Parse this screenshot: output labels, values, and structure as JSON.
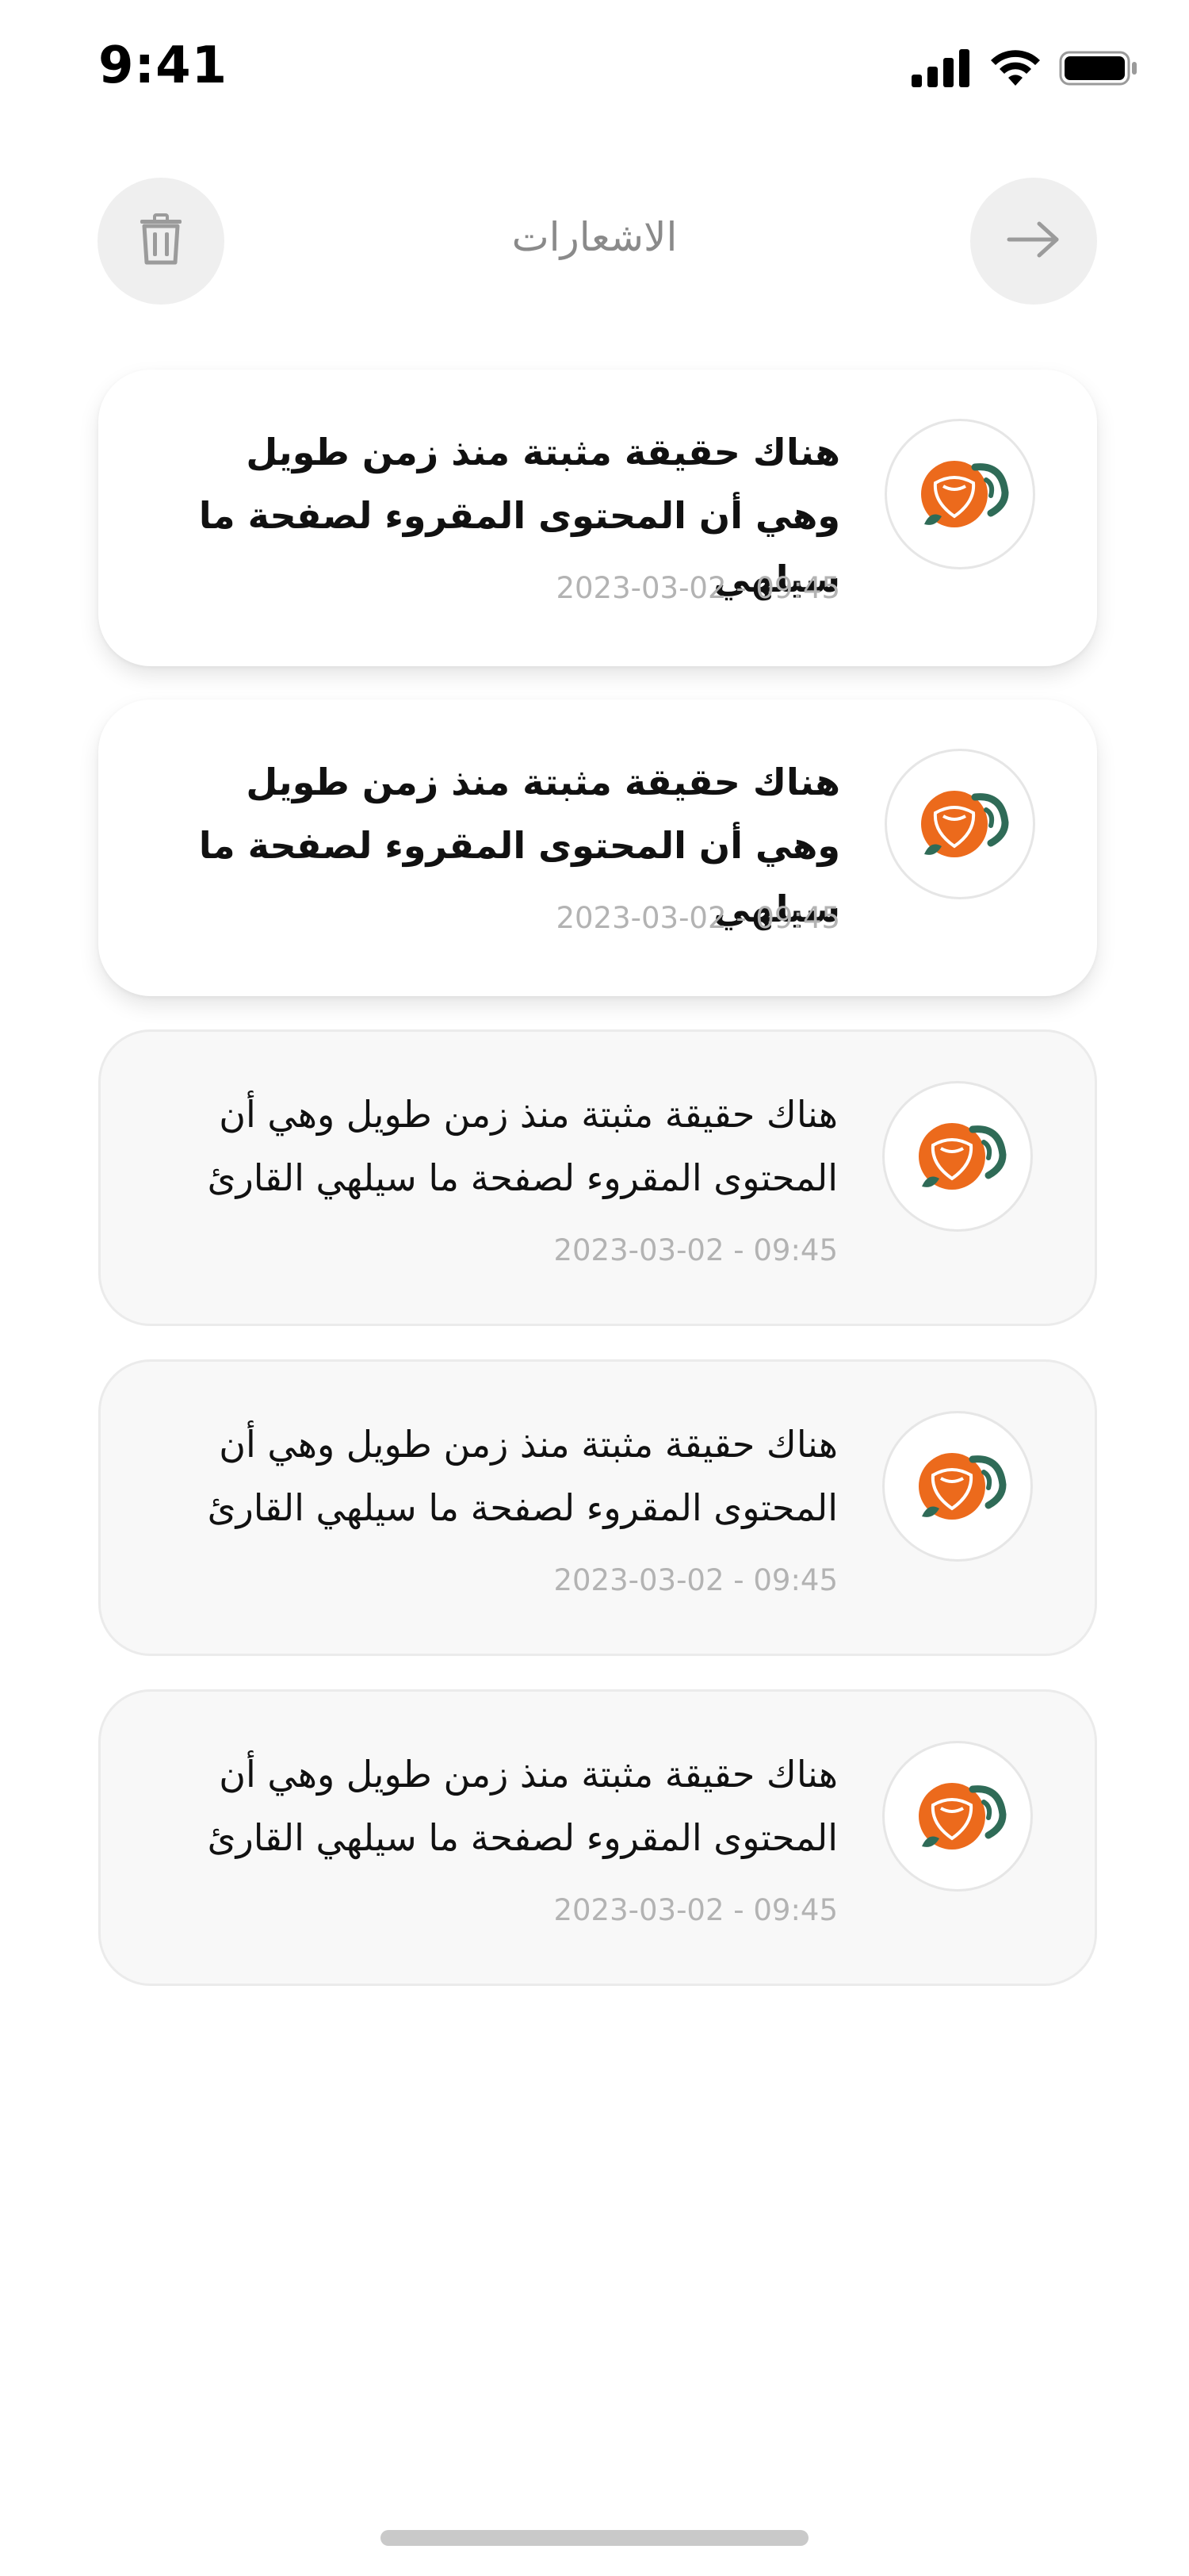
{
  "status_bar": {
    "time": "9:41",
    "icons": [
      "cellular-signal-icon",
      "wifi-icon",
      "battery-icon"
    ]
  },
  "header": {
    "title": "الاشعارات",
    "left_icon": "trash-icon",
    "right_icon": "arrow-right-icon"
  },
  "colors": {
    "brand_orange": "#ec6a1c",
    "brand_green": "#2f6b57",
    "unread_bg": "#ffffff",
    "read_bg": "#f8f8f8",
    "timestamp": "#b3b3b3",
    "title": "#8a8a8a"
  },
  "notifications": [
    {
      "text": "هناك حقيقة مثبتة منذ زمن طويل وهي أن المحتوى المقروء لصفحة ما سيلهي",
      "timestamp": "2023-03-02 - 09:45",
      "read": false,
      "icon": "brand-logo-icon"
    },
    {
      "text": "هناك حقيقة مثبتة منذ زمن طويل وهي أن المحتوى المقروء لصفحة ما سيلهي",
      "timestamp": "2023-03-02 - 09:45",
      "read": false,
      "icon": "brand-logo-icon"
    },
    {
      "text": "هناك حقيقة مثبتة منذ زمن طويل وهي أن المحتوى المقروء لصفحة ما سيلهي القارئ",
      "timestamp": "2023-03-02 - 09:45",
      "read": true,
      "icon": "brand-logo-icon"
    },
    {
      "text": "هناك حقيقة مثبتة منذ زمن طويل وهي أن المحتوى المقروء لصفحة ما سيلهي القارئ",
      "timestamp": "2023-03-02 - 09:45",
      "read": true,
      "icon": "brand-logo-icon"
    },
    {
      "text": "هناك حقيقة مثبتة منذ زمن طويل وهي أن المحتوى المقروء لصفحة ما سيلهي القارئ",
      "timestamp": "2023-03-02 - 09:45",
      "read": true,
      "icon": "brand-logo-icon"
    }
  ]
}
